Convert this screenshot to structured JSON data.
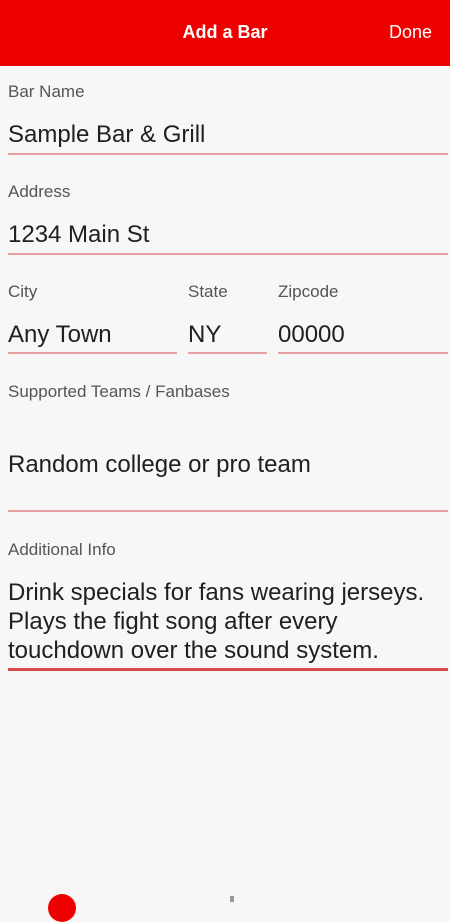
{
  "header": {
    "title": "Add a Bar",
    "done_label": "Done"
  },
  "form": {
    "bar_name": {
      "label": "Bar Name",
      "value": "Sample Bar & Grill"
    },
    "address": {
      "label": "Address",
      "value": "1234 Main St"
    },
    "city": {
      "label": "City",
      "value": "Any Town"
    },
    "state": {
      "label": "State",
      "value": "NY"
    },
    "zipcode": {
      "label": "Zipcode",
      "value": "00000"
    },
    "teams": {
      "label": "Supported Teams / Fanbases",
      "value": "Random college or pro team"
    },
    "additional_info": {
      "label": "Additional Info",
      "value": "Drink specials for fans wearing jerseys. Plays the fight song after every touchdown over the sound system."
    }
  },
  "colors": {
    "accent": "#ef0000",
    "underline": "#e7a3a3",
    "underline_active": "#d8494e"
  }
}
